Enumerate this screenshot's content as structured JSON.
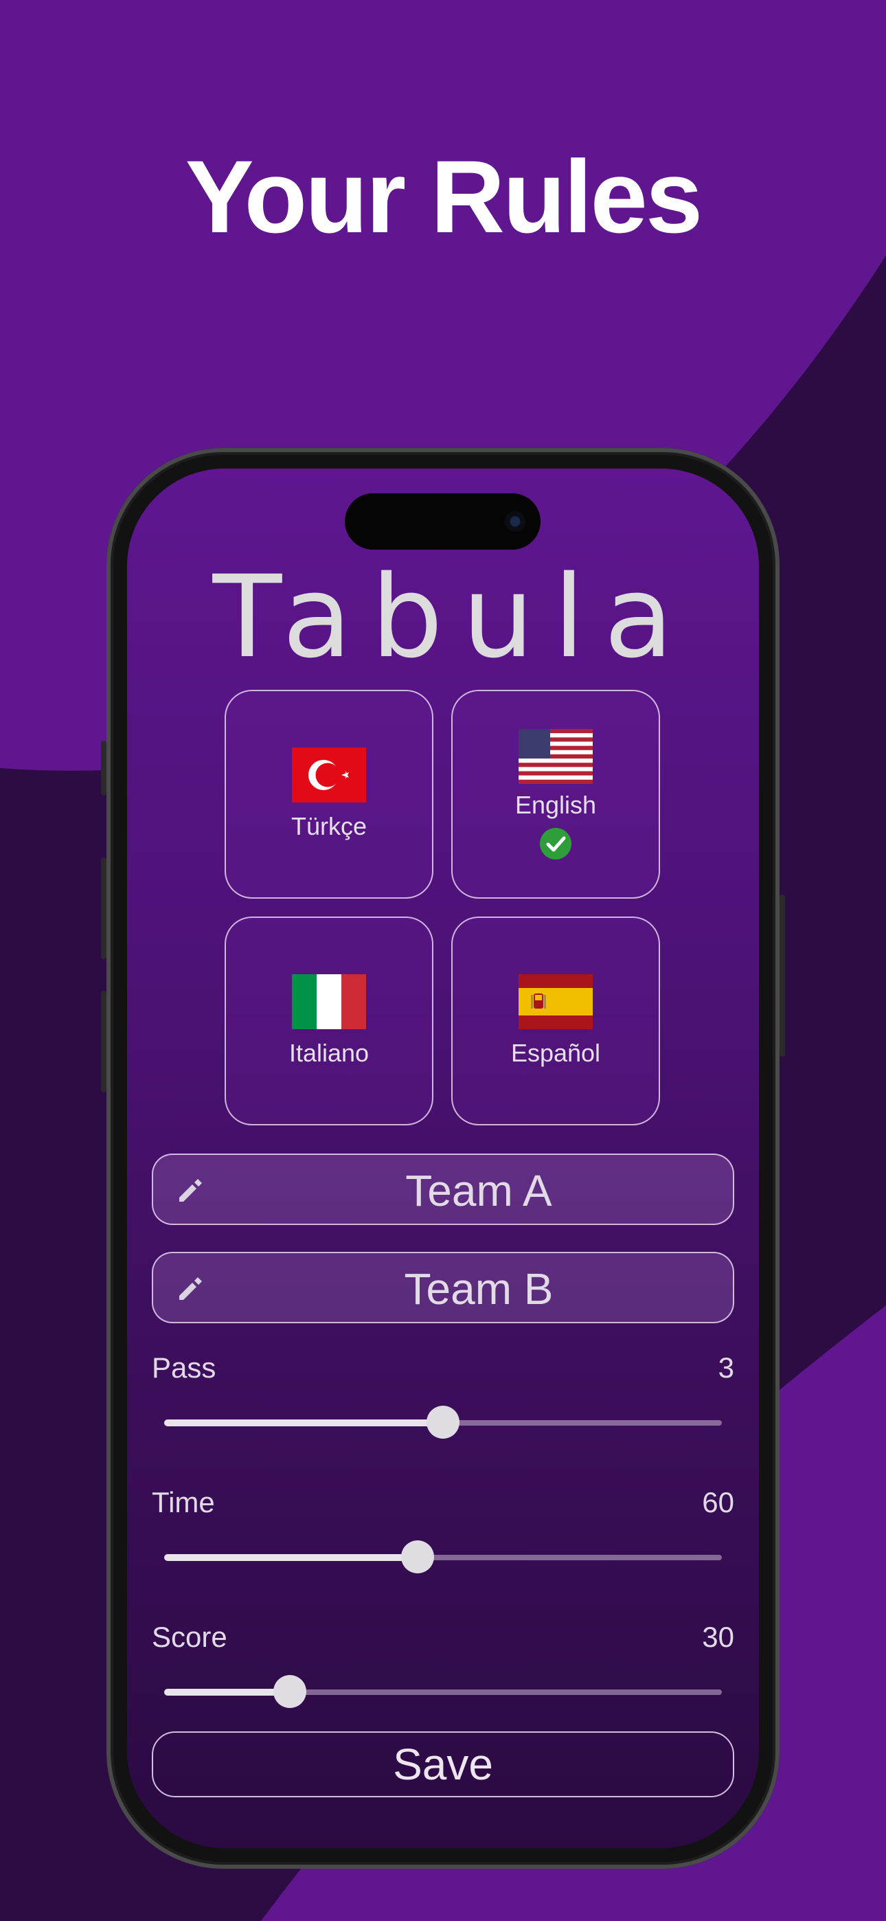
{
  "headline": "Your Rules",
  "app": {
    "title": "Tabula",
    "languages": [
      {
        "label": "Türkçe",
        "flag": "turkey-flag-icon",
        "selected": false
      },
      {
        "label": "English",
        "flag": "us-flag-icon",
        "selected": true
      },
      {
        "label": "Italiano",
        "flag": "italy-flag-icon",
        "selected": false
      },
      {
        "label": "Español",
        "flag": "spain-flag-icon",
        "selected": false
      }
    ],
    "teams": [
      {
        "name": "Team A",
        "icon": "pencil-icon"
      },
      {
        "name": "Team B",
        "icon": "pencil-icon"
      }
    ],
    "settings": [
      {
        "label": "Pass",
        "value": "3",
        "level": 0.5
      },
      {
        "label": "Time",
        "value": "60",
        "level": 0.455
      },
      {
        "label": "Score",
        "value": "30",
        "level": 0.225
      }
    ],
    "save_label": "Save"
  },
  "colors": {
    "background": "#5f168f",
    "dark_wave": "#2d0b43",
    "check": "#2d9e3a"
  }
}
